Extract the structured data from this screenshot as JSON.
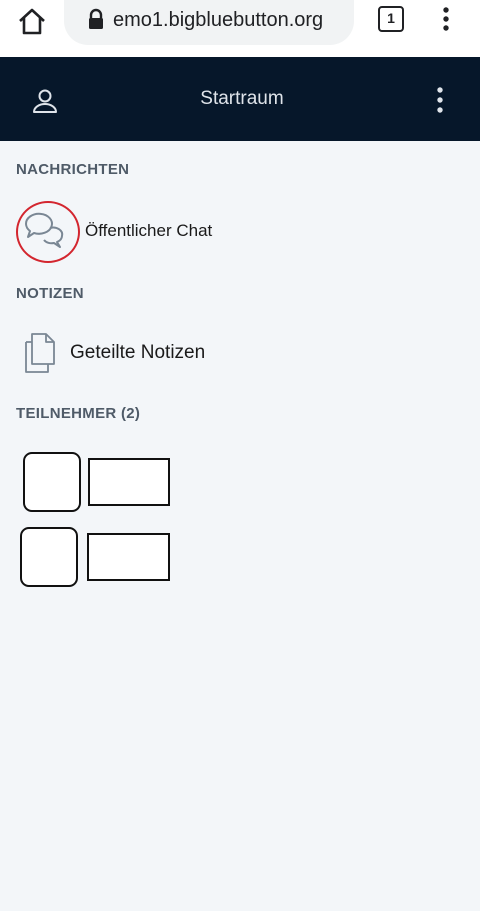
{
  "browser": {
    "url": "emo1.bigbluebutton.org",
    "tab_count": "1",
    "icons": [
      "home-icon",
      "lock-icon",
      "tab-switcher-icon",
      "more-vertical-icon"
    ]
  },
  "header": {
    "title": "Startraum",
    "icons": [
      "user-icon",
      "more-vertical-icon"
    ]
  },
  "sidebar": {
    "messages_heading": "NACHRICHTEN",
    "public_chat_label": "Öffentlicher Chat",
    "notes_heading": "NOTIZEN",
    "shared_notes_label": "Geteilte Notizen",
    "participants_heading": "TEILNEHMER (2)",
    "participants": [
      {
        "avatar": "",
        "name": ""
      },
      {
        "avatar": "",
        "name": ""
      }
    ]
  },
  "colors": {
    "header_bg": "#06172a",
    "panel_bg": "#f3f6f9",
    "highlight_circle": "#d3262f",
    "heading_text": "#4f5b68"
  }
}
